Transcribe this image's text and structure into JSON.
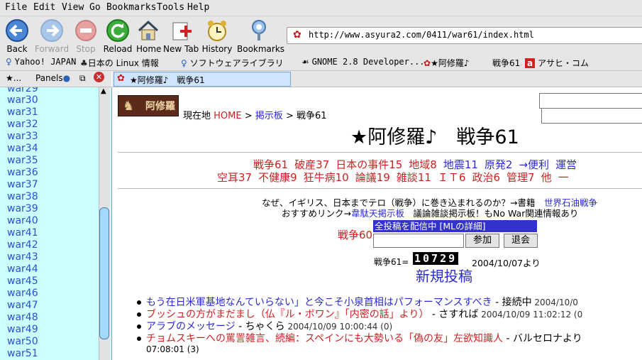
{
  "menu": [
    "File",
    "Edit",
    "View",
    "Go",
    "Bookmarks",
    "Tools",
    "Help"
  ],
  "toolbar": {
    "back": "Back",
    "forward": "Forward",
    "stop": "Stop",
    "reload": "Reload",
    "home": "Home",
    "newtab": "New Tab",
    "history": "History",
    "bookmarks": "Bookmarks"
  },
  "url": "http://www.asyura2.com/0411/war61/index.html",
  "bookmarks": [
    "Yahoo! JAPAN",
    "日本の Linux 情報",
    "ソフトウェアライブラリ",
    "GNOME 2.8 Developer...",
    "★阿修羅♪",
    "戦争61",
    "アサヒ・コム"
  ],
  "sidebar": {
    "header": "★...",
    "panels": "Panels",
    "items": [
      "war29",
      "war30",
      "war31",
      "war32",
      "war33",
      "war34",
      "war35",
      "war36",
      "war37",
      "war38",
      "war39",
      "war40",
      "war41",
      "war42",
      "war43",
      "war44",
      "war45",
      "war46",
      "war47",
      "war48",
      "war49",
      "war50",
      "war51"
    ]
  },
  "tab": {
    "title": "★阿修羅♪　戦争61"
  },
  "page": {
    "logo_text": "阿修羅",
    "location_label": "現在地",
    "crumb_home": "HOME",
    "crumb_sep1": ">",
    "crumb_board": "掲示板",
    "crumb_sep2": ">",
    "crumb_current": "戦争61",
    "title": "★阿修羅♪　戦争61",
    "nav_row1": [
      "戦争61",
      "破産37",
      "日本の事件15",
      "地域8",
      "地震11",
      "原発2",
      "→便利",
      "運営"
    ],
    "nav_row2": [
      "空耳37",
      "不健康9",
      "狂牛病10",
      "論議19",
      "雑談11",
      "ＩＴ6",
      "政治6",
      "管理7",
      "他",
      "一"
    ],
    "notice1_text": "なぜ、イギリス、日本までテロ（戦争）に巻き込まれるのか？→書籍",
    "notice1_link": "世界石油戦争",
    "notice2_prefix": "おすすめリンク→",
    "notice2_link": "韋駄天掲示板",
    "notice2_text": "議論雑談掲示板！もNo War関連情報あり",
    "prev_board": "戦争60",
    "ml_banner": "全投稿を配信中 [MLの詳細]",
    "join_button": "参加",
    "leave_button": "退会",
    "counter_label": "戦争61=",
    "counter_value": "10729",
    "counter_since": "2004/10/07より",
    "new_post": "新規投稿",
    "posts": [
      {
        "title": "もう在日米軍基地なんていらない」と今こそ小泉首相はパフォーマンスすべき",
        "author": " - 接続中",
        "date": " 2004/10/0"
      },
      {
        "title": "ブッシュの方がまだまし（仏『ル・ボワン』「内密の話」より）",
        "author": " - さすれば",
        "date": " 2004/10/09 11:02:12 (0"
      },
      {
        "title": "アラブのメッセージ",
        "author": " - ちゃくら",
        "date": " 2004/10/09 10:00:44 (0)"
      },
      {
        "title": "チョムスキーへの罵詈雑言、続編：スペインにも大勢いる「偽の友」左欲知識人",
        "author": " - バルセロナより",
        "date": ""
      }
    ],
    "post4_cont": "07:08:01 (3)"
  },
  "colors": {
    "sidebar_bg": "#ccffff",
    "link_red": "#cc2222",
    "link_blue": "#2b2bd6"
  }
}
